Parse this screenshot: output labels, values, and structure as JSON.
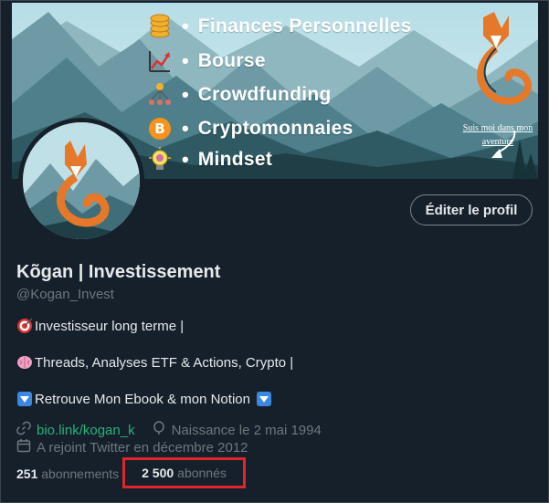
{
  "banner": {
    "topics": [
      {
        "icon": "coins-icon",
        "label": "Finances Personnelles"
      },
      {
        "icon": "chart-icon",
        "label": "Bourse"
      },
      {
        "icon": "people-network-icon",
        "label": "Crowdfunding"
      },
      {
        "icon": "bitcoin-icon",
        "label": "Cryptomonnaies"
      },
      {
        "icon": "lightbulb-brain-icon",
        "label": "Mindset"
      }
    ],
    "bullet": "•",
    "note_line1": "Suis moi dans mon",
    "note_line2": "aventure"
  },
  "profile": {
    "edit_button": "Éditer le profil",
    "name": "Kõgan | Investissement",
    "handle": "@Kogan_Invest",
    "bio": [
      {
        "icon": "target-icon",
        "text": "Investisseur long terme |"
      },
      {
        "icon": "brain-icon",
        "text": "Threads, Analyses ETF & Actions, Crypto |"
      },
      {
        "icon": "down-arrow-icon",
        "text": "Retrouve Mon Ebook & mon Notion",
        "trailing_icon": "down-arrow-icon"
      }
    ],
    "link": "bio.link/kogan_k",
    "birthday": "Naissance le 2 mai 1994",
    "joined": "A rejoint Twitter en décembre 2012",
    "following_count": "251",
    "following_label": "abonnements",
    "followers_count": "2 500",
    "followers_label": "abonnés"
  },
  "colors": {
    "background": "#15202b",
    "text": "#e7e9ea",
    "muted": "#71767b",
    "link": "#27b37a",
    "highlight": "#e0252b"
  }
}
